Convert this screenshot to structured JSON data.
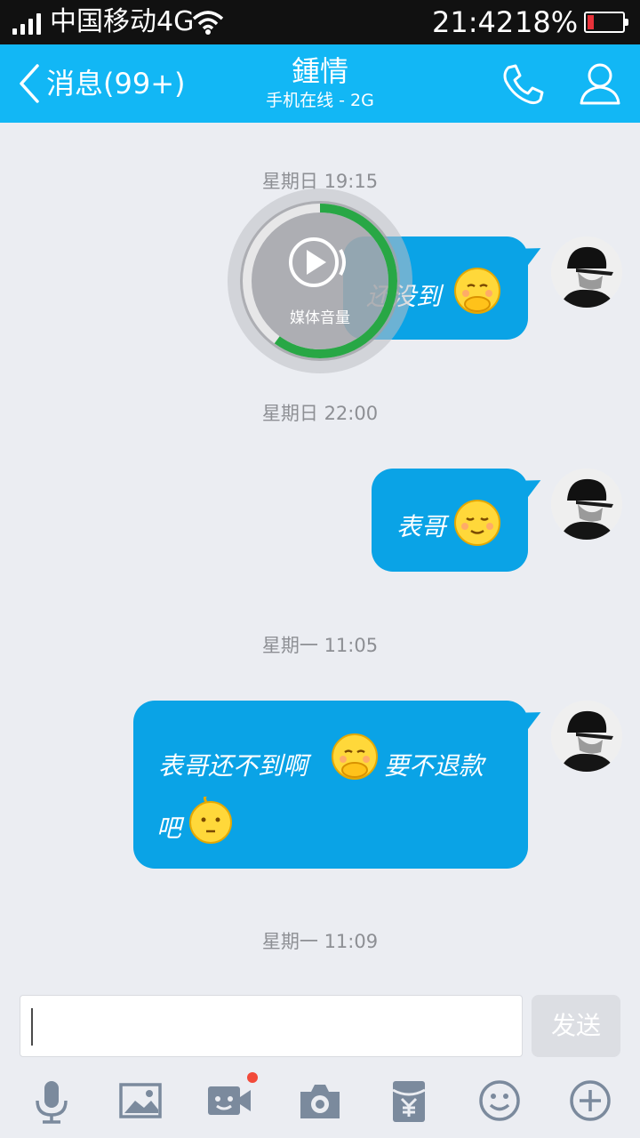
{
  "status_bar": {
    "carrier": "中国移动4G",
    "time": "21:42",
    "battery_percent": "18%",
    "battery_level": 0.18,
    "battery_color": "#e8323a"
  },
  "header": {
    "back_label": "消息(99+)",
    "contact_name": "鍾情",
    "contact_status": "手机在线 - 2G",
    "accent_color": "#12b7f5"
  },
  "chat": {
    "timestamps": [
      "星期日 19:15",
      "星期日 22:00",
      "星期一 11:05",
      "星期一 11:09"
    ],
    "messages": [
      {
        "lines": [
          "还没到"
        ],
        "emoji": [
          "emoji-shy-face"
        ]
      },
      {
        "lines": [
          "表哥"
        ],
        "emoji": [
          "emoji-smile-face"
        ]
      },
      {
        "lines": [
          "表哥还不到啊",
          "要不退款",
          "吧"
        ],
        "emoji": [
          "emoji-shy-face",
          "emoji-thinking-face"
        ]
      }
    ],
    "bubble_color": "#0aa3e6"
  },
  "volume_overlay": {
    "label": "媒体音量",
    "level": 0.6
  },
  "input_bar": {
    "value": "",
    "send_label": "发送",
    "tools": [
      "microphone-icon",
      "image-icon",
      "video-icon",
      "camera-icon",
      "red-packet-icon",
      "emoji-icon",
      "plus-icon"
    ]
  }
}
